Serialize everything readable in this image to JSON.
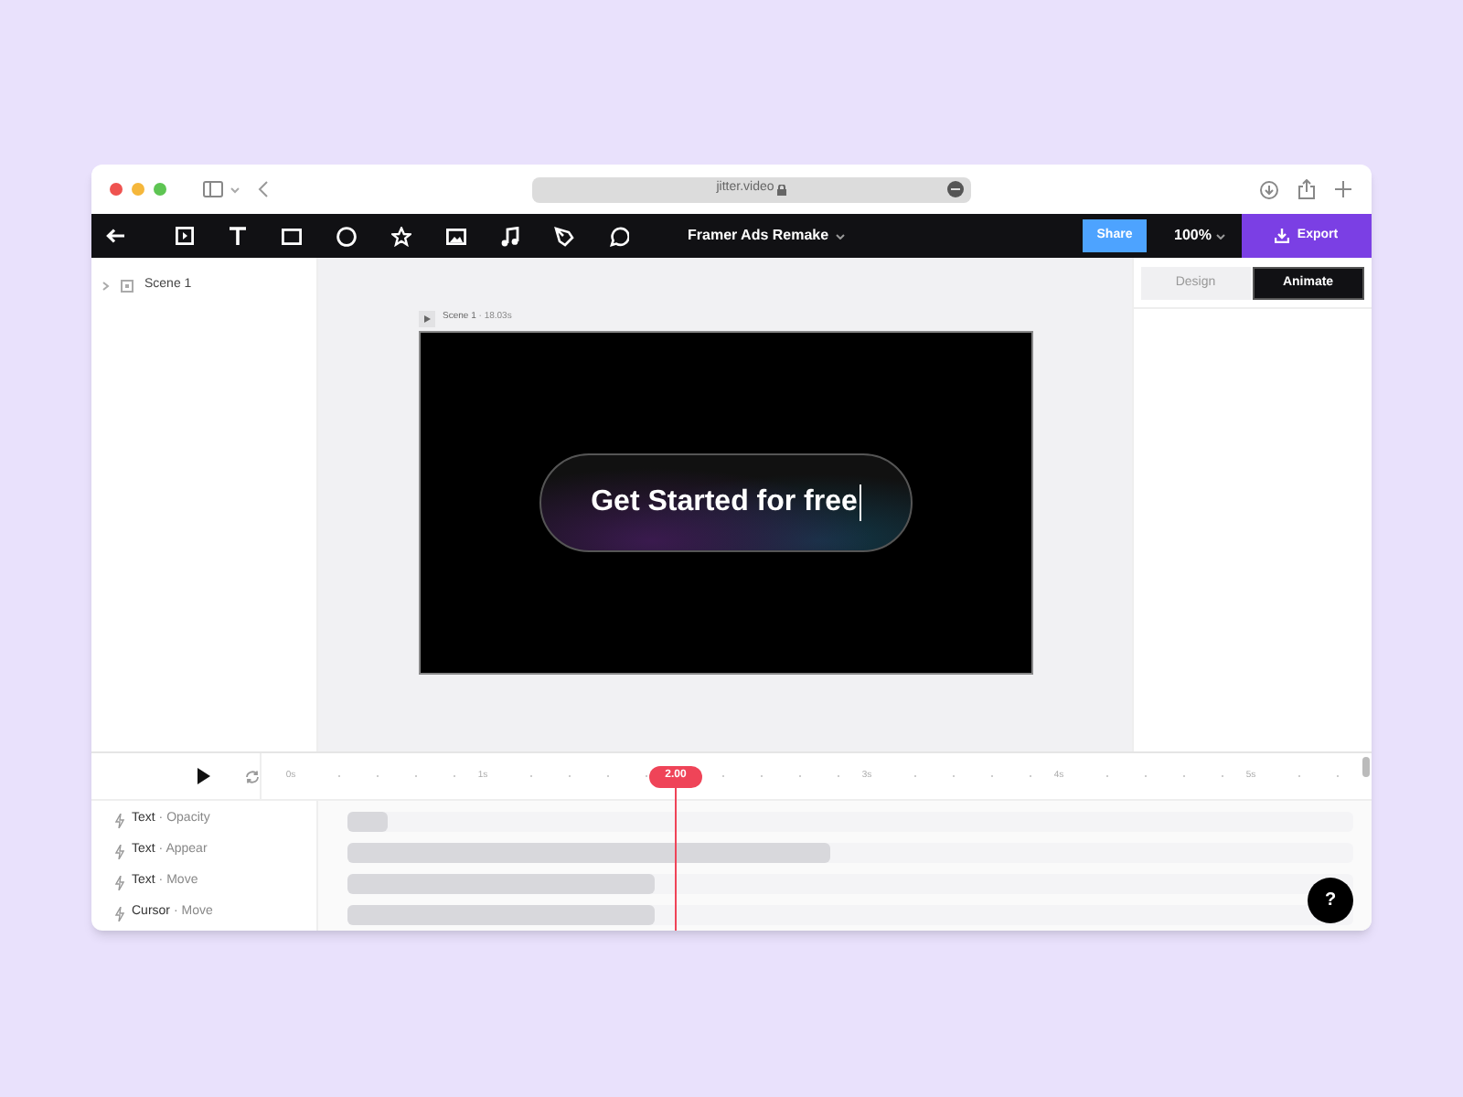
{
  "browser": {
    "url": "jitter.video"
  },
  "toolbar": {
    "project_title": "Framer Ads Remake",
    "share": "Share",
    "zoom": "100%",
    "export": "Export"
  },
  "layers": [
    {
      "label": "Scene 1",
      "expanded": false
    }
  ],
  "canvas": {
    "scene": "Scene 1",
    "separator": "·",
    "duration": "18.03s",
    "text": "Get Started for free"
  },
  "panel_tabs": [
    {
      "label": "Design",
      "selected": false
    },
    {
      "label": "Animate",
      "selected": true
    }
  ],
  "timeline": {
    "ruler": [
      {
        "kind": "second",
        "label": "0s"
      },
      {
        "kind": "second",
        "label": "1s"
      },
      {
        "kind": "playhead",
        "label": "2.00"
      },
      {
        "kind": "second",
        "label": "3s"
      },
      {
        "kind": "second",
        "label": "4s"
      },
      {
        "kind": "second",
        "label": "5s"
      }
    ],
    "tracks": [
      {
        "target": "Text",
        "separator": "·",
        "action": "Opacity",
        "level": 0.04
      },
      {
        "target": "Text",
        "separator": "·",
        "action": "Appear",
        "level": 0.48
      },
      {
        "target": "Text",
        "separator": "·",
        "action": "Move",
        "level": 0.305
      },
      {
        "target": "Cursor",
        "separator": "·",
        "action": "Move",
        "level": 0.305
      }
    ]
  },
  "help": "?"
}
